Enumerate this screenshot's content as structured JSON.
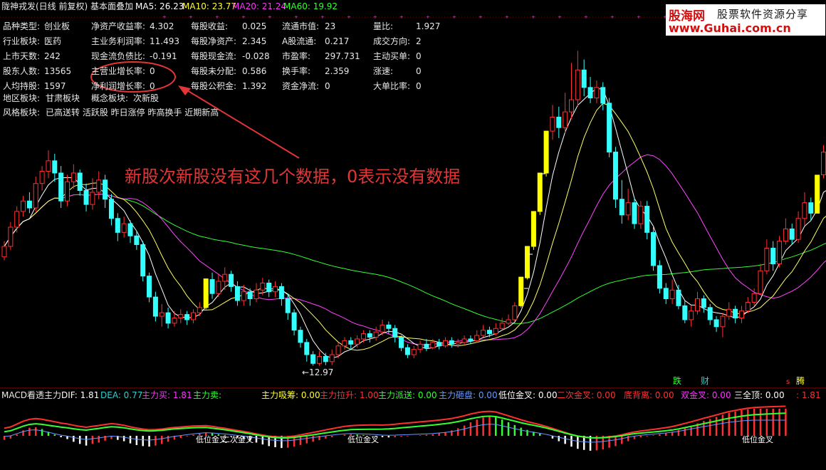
{
  "header": {
    "title": "陇神戎发(日线 前复权) 基本面叠加",
    "ma5": "MA5: 26.23",
    "ma10": "MA10: 23.77",
    "ma20": "MA20: 21.24",
    "ma60": "MA60: 19.92"
  },
  "logo": {
    "name": "股海网",
    "slogan": "股票软件资源分享",
    "url": "www.Guhai.com.cn"
  },
  "info": [
    [
      {
        "k": "品种类型:",
        "v": "创业板"
      },
      {
        "k": "净资产收益率:",
        "v": "4.302"
      },
      {
        "k": "每股收益:",
        "v": "0.025"
      },
      {
        "k": "流通市值:",
        "v": "23"
      },
      {
        "k": "量比:",
        "v": "1.927"
      }
    ],
    [
      {
        "k": "行业板块:",
        "v": "医药"
      },
      {
        "k": "主业务利润率:",
        "v": "11.493"
      },
      {
        "k": "每股净资产:",
        "v": "2.345"
      },
      {
        "k": "A股流通:",
        "v": "0.217"
      },
      {
        "k": "成交方向:",
        "v": "2"
      }
    ],
    [
      {
        "k": "上市天数:",
        "v": "242"
      },
      {
        "k": "现金流负债比:",
        "v": "-0.191"
      },
      {
        "k": "每股现金流:",
        "v": "-0.028"
      },
      {
        "k": "市盈率:",
        "v": "297.731"
      },
      {
        "k": "主动买单:",
        "v": "0"
      }
    ],
    [
      {
        "k": "股东人数:",
        "v": "13565"
      },
      {
        "k": "主营业增长率:",
        "v": "0"
      },
      {
        "k": "每股未分配:",
        "v": "0.586"
      },
      {
        "k": "换手率:",
        "v": "2.359"
      },
      {
        "k": "涨速:",
        "v": "0"
      }
    ],
    [
      {
        "k": "人均持股:",
        "v": "1597"
      },
      {
        "k": "净利润增长率:",
        "v": "0"
      },
      {
        "k": "每股公积金:",
        "v": "1.392"
      },
      {
        "k": "资金净流:",
        "v": "0"
      },
      {
        "k": "大单比率:",
        "v": "0"
      }
    ]
  ],
  "region": {
    "k": "地区板块:",
    "v": "甘肃板块",
    "k2": "概念板块:",
    "v2": "次新股"
  },
  "style": {
    "k": "风格板块:",
    "v": "已高送转 活跃股 昨日涨停 昨高换手 近期新高"
  },
  "annotation": "新股次新股没有这几个数据，0表示没有数据",
  "low_price": "←12.97",
  "markers": {
    "die": "跌",
    "cai": "财",
    "teng": "腾",
    "s": "s"
  },
  "macd_header": [
    {
      "t": "MACD看透主力",
      "c": "w"
    },
    {
      "t": "DIF: 1.81",
      "c": "wl"
    },
    {
      "t": "DEA: 0.77",
      "c": "c"
    },
    {
      "t": "主力买: 1.81",
      "c": "m"
    },
    {
      "t": "主力卖: ",
      "c": "g"
    },
    {
      "t": "主力吸筹: 0.00",
      "c": "y"
    },
    {
      "t": "主力拉升: 1.00",
      "c": "r"
    },
    {
      "t": "主力派送: 0.00",
      "c": "g"
    },
    {
      "t": "主力砸盘: 0.00",
      "c": "bl"
    },
    {
      "t": "低位金叉: 0.00",
      "c": "wl"
    },
    {
      "t": "二次金叉: 0.00",
      "c": "r"
    },
    {
      "t": "底背离: 0.00",
      "c": "r"
    },
    {
      "t": "双金叉: 0.00",
      "c": "m"
    },
    {
      "t": "三全顶: 0.00",
      "c": "wl"
    },
    {
      "t": ": 1.81",
      "c": "r"
    }
  ],
  "macd_labels": [
    "低位金叉",
    "二次金叉",
    "低位金叉",
    "低位金叉"
  ],
  "colors": {
    "up": "#ff3030",
    "down": "#33ffff",
    "limit": "#ffff00",
    "ma5": "#ffffff",
    "ma10": "#ffff66",
    "ma20": "#ff44ff",
    "ma60": "#33ff33",
    "annot": "#e33535"
  },
  "chart_data": {
    "type": "candlestick",
    "low_marker": 12.97,
    "candles": [
      [
        19.2,
        19.8,
        19.0,
        20.1
      ],
      [
        19.8,
        20.9,
        19.6,
        21.2
      ],
      [
        20.9,
        21.8,
        20.6,
        22.1
      ],
      [
        21.8,
        22.4,
        21.5,
        22.7
      ],
      [
        22.4,
        22.0,
        21.7,
        22.9
      ],
      [
        22.0,
        23.4,
        21.8,
        23.8
      ],
      [
        23.4,
        24.1,
        23.0,
        24.4
      ],
      [
        24.1,
        24.7,
        23.7,
        25.3
      ],
      [
        24.7,
        24.0,
        23.5,
        25.1
      ],
      [
        24.0,
        22.4,
        22.0,
        24.4
      ],
      [
        22.4,
        23.5,
        22.1,
        23.9
      ],
      [
        23.5,
        24.0,
        23.1,
        24.5
      ],
      [
        24.0,
        23.0,
        22.7,
        24.2
      ],
      [
        23.0,
        22.2,
        21.8,
        23.4
      ],
      [
        22.2,
        22.9,
        21.9,
        23.7
      ],
      [
        22.9,
        23.6,
        22.5,
        24.1
      ],
      [
        23.6,
        22.5,
        22.0,
        23.9
      ],
      [
        22.5,
        21.4,
        21.0,
        22.8
      ],
      [
        21.4,
        20.6,
        20.1,
        21.7
      ],
      [
        20.6,
        21.1,
        20.3,
        21.5
      ],
      [
        21.1,
        20.4,
        20.0,
        21.3
      ],
      [
        20.4,
        19.9,
        19.6,
        20.7
      ],
      [
        19.9,
        18.1,
        17.8,
        20.1
      ],
      [
        18.1,
        16.9,
        16.6,
        18.3
      ],
      [
        16.9,
        15.8,
        15.5,
        17.2
      ],
      [
        15.8,
        16.0,
        15.2,
        16.5
      ],
      [
        16.0,
        15.4,
        15.1,
        16.3
      ],
      [
        15.4,
        15.7,
        15.2,
        16.1
      ],
      [
        15.7,
        15.9,
        15.4,
        16.2
      ],
      [
        15.9,
        15.6,
        15.3,
        16.1
      ],
      [
        15.6,
        16.0,
        15.4,
        16.2
      ],
      [
        16.0,
        16.3,
        15.8,
        16.6
      ],
      [
        16.3,
        17.94,
        16.2,
        17.94
      ],
      [
        17.9,
        17.1,
        16.8,
        18.3
      ],
      [
        17.1,
        17.8,
        16.9,
        18.2
      ],
      [
        17.8,
        18.2,
        17.3,
        18.6
      ],
      [
        18.2,
        17.5,
        17.2,
        18.4
      ],
      [
        17.5,
        16.7,
        16.4,
        17.8
      ],
      [
        16.7,
        17.2,
        16.4,
        17.6
      ],
      [
        17.2,
        16.8,
        16.4,
        17.4
      ],
      [
        16.8,
        17.3,
        16.6,
        17.7
      ],
      [
        17.3,
        17.7,
        17.0,
        18.0
      ],
      [
        17.7,
        17.2,
        16.9,
        17.9
      ],
      [
        17.2,
        17.5,
        16.9,
        17.8
      ],
      [
        17.5,
        16.8,
        16.4,
        17.7
      ],
      [
        16.8,
        16.0,
        15.6,
        17.1
      ],
      [
        16.0,
        15.0,
        14.7,
        16.2
      ],
      [
        15.0,
        14.3,
        14.0,
        15.2
      ],
      [
        14.3,
        13.6,
        13.2,
        14.5
      ],
      [
        13.6,
        13.1,
        12.97,
        13.8
      ],
      [
        13.1,
        13.5,
        12.97,
        13.8
      ],
      [
        13.5,
        13.2,
        13.0,
        13.7
      ],
      [
        13.2,
        13.6,
        13.0,
        13.9
      ],
      [
        13.6,
        14.1,
        13.4,
        14.3
      ],
      [
        14.1,
        14.4,
        13.9,
        14.6
      ],
      [
        14.4,
        14.2,
        13.9,
        14.6
      ],
      [
        14.2,
        14.5,
        14.0,
        14.7
      ],
      [
        14.5,
        14.8,
        14.3,
        15.0
      ],
      [
        14.8,
        14.6,
        14.3,
        15.0
      ],
      [
        14.6,
        14.9,
        14.4,
        15.2
      ],
      [
        14.9,
        15.3,
        14.7,
        15.6
      ],
      [
        15.3,
        15.1,
        14.8,
        15.5
      ],
      [
        15.1,
        14.6,
        14.3,
        15.3
      ],
      [
        14.6,
        14.0,
        13.8,
        14.7
      ],
      [
        14.0,
        13.6,
        13.4,
        14.2
      ],
      [
        13.6,
        13.9,
        13.4,
        14.1
      ],
      [
        13.9,
        14.2,
        13.7,
        14.4
      ],
      [
        14.2,
        14.0,
        13.8,
        14.5
      ],
      [
        14.0,
        14.3,
        13.9,
        14.5
      ],
      [
        14.3,
        14.1,
        13.9,
        14.5
      ],
      [
        14.1,
        14.4,
        14.0,
        14.6
      ],
      [
        14.4,
        14.2,
        14.0,
        14.6
      ],
      [
        14.2,
        14.3,
        14.0,
        14.5
      ],
      [
        14.3,
        14.5,
        14.1,
        14.7
      ],
      [
        14.5,
        14.4,
        14.2,
        14.7
      ],
      [
        14.4,
        14.7,
        14.3,
        15.0
      ],
      [
        14.7,
        15.0,
        14.6,
        15.3
      ],
      [
        15.0,
        14.8,
        14.6,
        15.2
      ],
      [
        14.8,
        15.1,
        14.7,
        15.4
      ],
      [
        15.1,
        15.4,
        15.0,
        15.7
      ],
      [
        15.4,
        15.6,
        15.3,
        15.9
      ],
      [
        15.6,
        16.4,
        15.5,
        16.6
      ],
      [
        16.4,
        18.04,
        16.3,
        18.04
      ],
      [
        18.0,
        19.8,
        17.9,
        19.8
      ],
      [
        19.8,
        21.8,
        19.6,
        21.8
      ],
      [
        21.8,
        24.0,
        21.6,
        24.0
      ],
      [
        24.0,
        26.4,
        23.8,
        26.4
      ],
      [
        26.4,
        27.2,
        25.9,
        27.9
      ],
      [
        27.2,
        26.6,
        26.0,
        27.8
      ],
      [
        26.6,
        27.5,
        26.3,
        28.6
      ],
      [
        27.5,
        28.2,
        27.1,
        30.3
      ],
      [
        28.2,
        29.9,
        27.8,
        31.0
      ],
      [
        29.9,
        28.9,
        28.4,
        30.5
      ],
      [
        28.9,
        28.3,
        28.0,
        29.5
      ],
      [
        28.3,
        28.9,
        28.0,
        29.3
      ],
      [
        28.9,
        28.0,
        27.6,
        29.2
      ],
      [
        28.0,
        25.2,
        24.9,
        28.3
      ],
      [
        25.2,
        22.5,
        22.0,
        25.5
      ],
      [
        22.5,
        21.6,
        21.1,
        23.6
      ],
      [
        21.6,
        22.3,
        21.3,
        23.1
      ],
      [
        22.3,
        21.1,
        20.8,
        22.6
      ],
      [
        21.1,
        22.1,
        20.8,
        22.4
      ],
      [
        22.1,
        20.6,
        20.2,
        22.4
      ],
      [
        20.6,
        18.7,
        18.4,
        20.9
      ],
      [
        18.7,
        17.4,
        17.1,
        19.0
      ],
      [
        17.4,
        16.8,
        16.5,
        17.7
      ],
      [
        16.8,
        17.3,
        16.5,
        17.9
      ],
      [
        17.3,
        16.4,
        16.2,
        17.6
      ],
      [
        16.4,
        15.6,
        15.4,
        16.7
      ],
      [
        15.6,
        16.1,
        15.2,
        16.4
      ],
      [
        16.1,
        16.8,
        15.9,
        17.2
      ],
      [
        16.8,
        16.3,
        16.0,
        17.0
      ],
      [
        16.3,
        15.6,
        15.3,
        16.5
      ],
      [
        15.6,
        15.2,
        14.9,
        15.8
      ],
      [
        15.2,
        15.8,
        14.6,
        16.0
      ],
      [
        15.8,
        16.2,
        15.6,
        16.6
      ],
      [
        16.2,
        15.7,
        15.4,
        16.4
      ],
      [
        15.7,
        16.1,
        15.4,
        16.4
      ],
      [
        16.1,
        16.6,
        16.0,
        16.9
      ],
      [
        16.6,
        17.1,
        16.4,
        17.4
      ],
      [
        17.1,
        18.4,
        17.0,
        18.8
      ],
      [
        18.4,
        19.7,
        18.2,
        20.2
      ],
      [
        19.7,
        18.8,
        18.4,
        20.1
      ],
      [
        18.8,
        20.1,
        18.6,
        20.4
      ],
      [
        20.1,
        20.8,
        19.9,
        21.4
      ],
      [
        20.8,
        20.2,
        19.9,
        21.1
      ],
      [
        20.2,
        21.4,
        20.0,
        21.8
      ],
      [
        21.4,
        22.3,
        21.0,
        22.9
      ],
      [
        22.3,
        21.7,
        21.3,
        22.6
      ],
      [
        21.7,
        23.88,
        21.7,
        23.88
      ],
      [
        23.9,
        25.2,
        23.7,
        25.6
      ],
      [
        25.2,
        22.6,
        22.3,
        25.4
      ],
      [
        22.6,
        26.27,
        22.6,
        26.27
      ],
      [
        26.3,
        28.9,
        26.0,
        29.3
      ],
      [
        28.9,
        31.8,
        28.6,
        32.3
      ]
    ],
    "macd": [
      -0.15,
      -0.1,
      0.05,
      0.2,
      0.3,
      0.32,
      0.25,
      0.15,
      0.05,
      -0.05,
      -0.12,
      -0.22,
      -0.3,
      -0.36,
      -0.3,
      -0.25,
      -0.18,
      -0.12,
      -0.15,
      -0.2,
      -0.28,
      -0.34,
      -0.38,
      -0.4,
      -0.36,
      -0.3,
      -0.22,
      -0.14,
      -0.08,
      -0.02,
      0.04,
      0.08,
      0.12,
      0.1,
      0.06,
      0.03,
      -0.02,
      -0.07,
      -0.12,
      -0.18,
      -0.25,
      -0.32,
      -0.38,
      -0.42,
      -0.45,
      -0.44,
      -0.4,
      -0.34,
      -0.28,
      -0.22,
      -0.16,
      -0.1,
      -0.05,
      0.0,
      0.04,
      0.06,
      0.05,
      0.03,
      0.01,
      -0.02,
      -0.05,
      -0.06,
      -0.05,
      -0.03,
      -0.02,
      0.0,
      0.02,
      0.04,
      0.06,
      0.1,
      0.14,
      0.2,
      0.28,
      0.38,
      0.5,
      0.6,
      0.68,
      0.72,
      0.7,
      0.6,
      0.5,
      0.4,
      0.3,
      0.22,
      0.15,
      0.08,
      0.0,
      -0.1,
      -0.2,
      -0.3,
      -0.4,
      -0.48,
      -0.52,
      -0.55,
      -0.54,
      -0.5,
      -0.44,
      -0.38,
      -0.3,
      -0.2,
      -0.12,
      -0.06,
      -0.02,
      0.02,
      0.06,
      0.1,
      0.15,
      0.22,
      0.3,
      0.38,
      0.46,
      0.55,
      0.62,
      0.7,
      0.78,
      0.85,
      0.9,
      0.95,
      0.98,
      1.0,
      1.0,
      1.0,
      1.0,
      1.0,
      1.0
    ]
  }
}
